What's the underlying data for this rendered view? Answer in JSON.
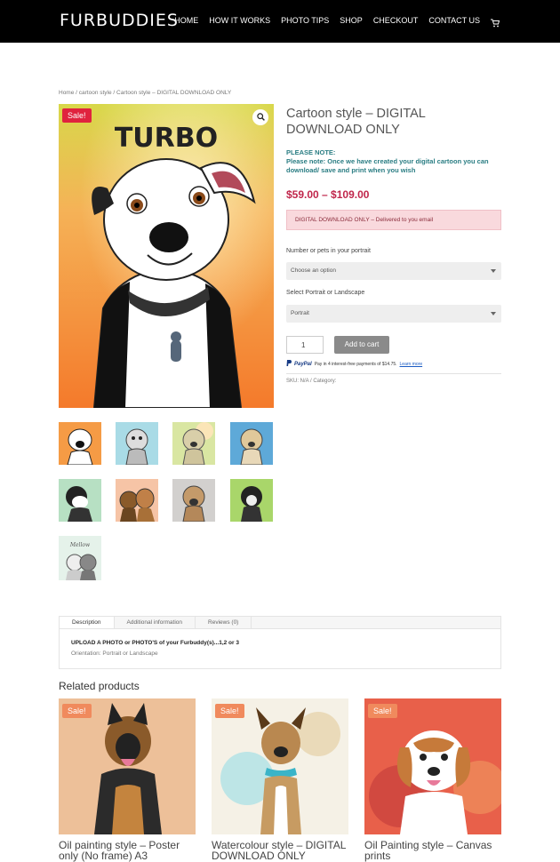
{
  "header": {
    "logo": "FURBUDDIES",
    "nav": [
      "HOME",
      "HOW IT WORKS",
      "PHOTO TIPS",
      "SHOP",
      "CHECKOUT",
      "CONTACT US"
    ],
    "cart_icon": "cart-icon"
  },
  "breadcrumb": {
    "home": "Home",
    "sep": " / ",
    "cat": "cartoon style",
    "current": "Cartoon style – DIGITAL DOWNLOAD ONLY"
  },
  "product": {
    "sale_badge": "Sale!",
    "image_caption": "TURBO",
    "title": "Cartoon style – DIGITAL DOWNLOAD ONLY",
    "note_head": "PLEASE NOTE:",
    "note_body": "Please note: Once we have created your digital cartoon you can download/ save and print when you wish",
    "price": "$59.00 – $109.00",
    "notice": "DIGITAL DOWNLOAD ONLY – Delivered to you email",
    "option1_label": "Number or pets in your portrait",
    "option1_value": "Choose an option",
    "option2_label": "Select Portrait or Landscape",
    "option2_value": "Portrait",
    "quantity": "1",
    "add_to_cart": "Add to cart",
    "paypal_brand": "PayPal",
    "paypal_text": "Pay in 4 interest-free payments of $14.75.",
    "paypal_learn": "Learn more",
    "sku": "SKU: N/A / Category:"
  },
  "tabs": {
    "items": [
      "Description",
      "Additional information",
      "Reviews (0)"
    ],
    "content_head": "UPLOAD A PHOTO or PHOTO'S of your Furbuddy(s)...1,2 or 3",
    "content_body": "Orientation: Portrait or Landscape"
  },
  "related": {
    "heading": "Related products",
    "items": [
      {
        "badge": "Sale!",
        "title": "Oil painting style – Poster only (No frame) A3"
      },
      {
        "badge": "Sale!",
        "title": "Watercolour style – DIGITAL DOWNLOAD ONLY"
      },
      {
        "badge": "Sale!",
        "title": "Oil Painting style – Canvas prints"
      }
    ]
  },
  "colors": {
    "header_bg": "#000000",
    "sale": "#e0233e",
    "price": "#c0264b",
    "note": "#2a7d83",
    "notice_bg": "#f9d9dd"
  }
}
